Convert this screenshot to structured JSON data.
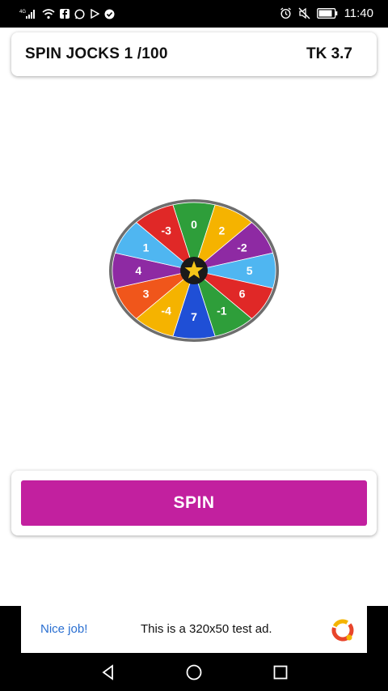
{
  "status_bar": {
    "network_label": "4G",
    "time": "11:40",
    "icons": [
      "signal-icon",
      "wifi-icon",
      "facebook-icon",
      "whatsapp-icon",
      "play-icon",
      "check-icon",
      "alarm-icon",
      "mute-icon",
      "battery-icon"
    ]
  },
  "header": {
    "title": "SPIN JOCKS 1 /100",
    "balance": "TK 3.7"
  },
  "wheel": {
    "center_icon": "star-icon",
    "segments": [
      {
        "label": "0",
        "color": "#2e9e3a"
      },
      {
        "label": "2",
        "color": "#f5b300"
      },
      {
        "label": "-2",
        "color": "#8e2aa3"
      },
      {
        "label": "5",
        "color": "#4fb6f1"
      },
      {
        "label": "6",
        "color": "#e02827"
      },
      {
        "label": "-1",
        "color": "#2e9e3a"
      },
      {
        "label": "7",
        "color": "#1f4fd6"
      },
      {
        "label": "-4",
        "color": "#f5b300"
      },
      {
        "label": "3",
        "color": "#f0561b"
      },
      {
        "label": "4",
        "color": "#8e2aa3"
      },
      {
        "label": "1",
        "color": "#4fb6f1"
      },
      {
        "label": "-3",
        "color": "#e02827"
      }
    ]
  },
  "spin": {
    "label": "SPIN",
    "color": "#c2209f"
  },
  "ad": {
    "nice": "Nice job!",
    "text": "This is a 320x50 test ad."
  },
  "nav": {
    "icons": [
      "back-icon",
      "home-icon",
      "recents-icon"
    ]
  }
}
